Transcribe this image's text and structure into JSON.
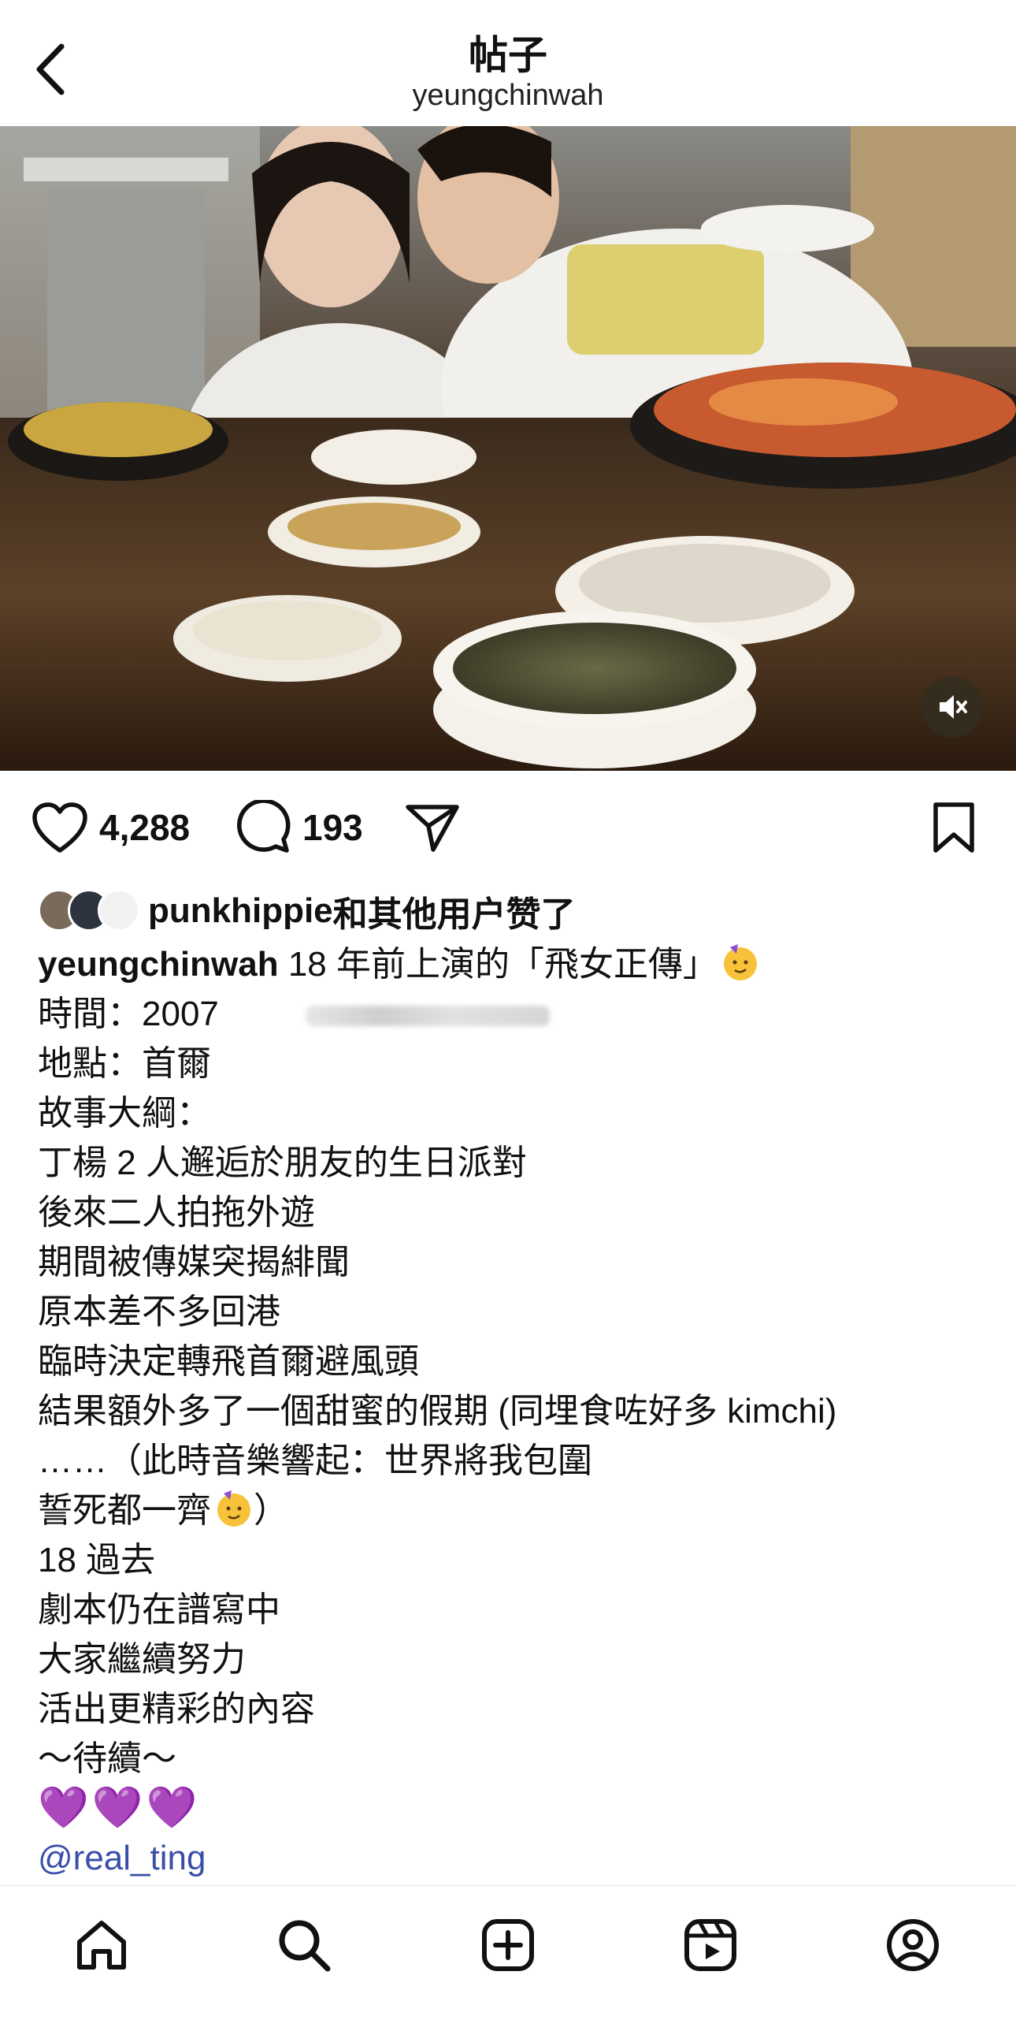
{
  "header": {
    "title": "帖子",
    "username": "yeungchinwah"
  },
  "post": {
    "image_alt_icon": "photo",
    "mute_icon": "speaker-muted-icon"
  },
  "actions": {
    "like_count": "4,288",
    "comment_count": "193"
  },
  "likes": {
    "liker": "punkhippie",
    "suffix": "和其他用户赞了"
  },
  "caption": {
    "username": "yeungchinwah",
    "line1_text": " 18 年前上演的「飛女正傳」",
    "lines": [
      "時間：2007",
      "地點：首爾",
      "故事大綱：",
      "丁楊 2 人邂逅於朋友的生日派對",
      "後來二人拍拖外遊",
      "期間被傳媒突揭緋聞",
      "原本差不多回港",
      "臨時決定轉飛首爾避風頭",
      "結果額外多了一個甜蜜的假期 (同埋食咗好多 kimchi)",
      "……（此時音樂響起：世界將我包圍",
      "誓死都一齊",
      "18 過去",
      "劇本仍在譜寫中",
      "大家繼續努力",
      "活出更精彩的內容",
      "～待續～"
    ],
    "line11_suffix": "）",
    "hearts": "💜💜💜",
    "mention": "@real_ting"
  },
  "tabs": [
    "home-icon",
    "search-icon",
    "create-icon",
    "reels-icon",
    "profile-icon"
  ],
  "colors": {
    "mention": "#3a4ea8",
    "heart_emoji": "#9b3fe0",
    "text": "#111111"
  }
}
